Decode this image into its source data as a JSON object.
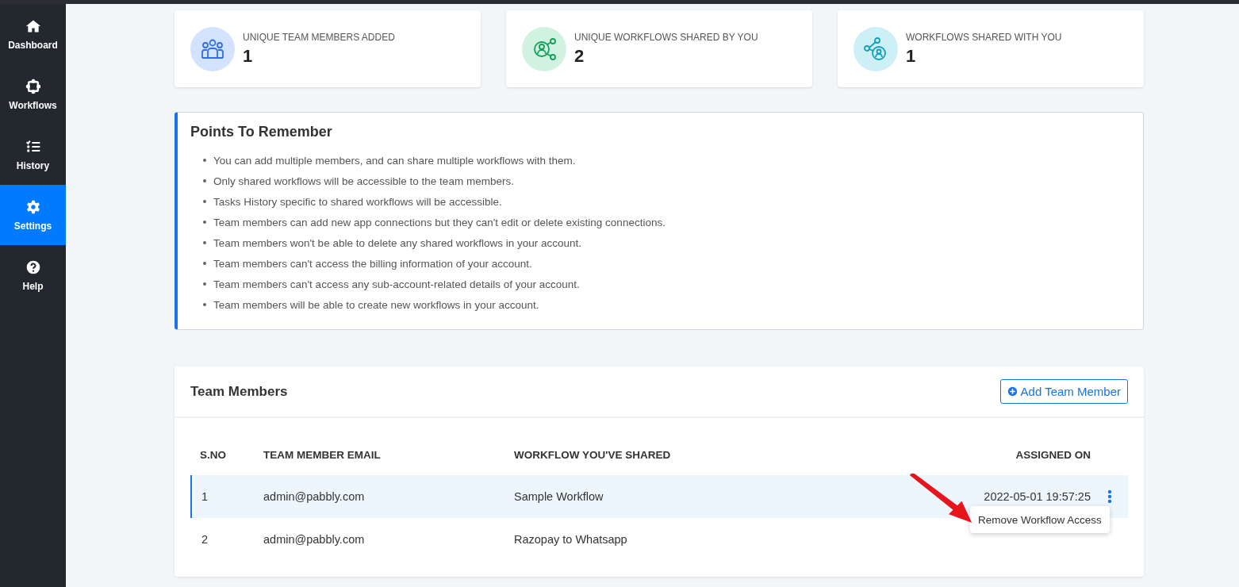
{
  "sidebar": {
    "items": [
      {
        "label": "Dashboard",
        "kind": "home",
        "selected": false
      },
      {
        "label": "Workflows",
        "kind": "workflow",
        "selected": false
      },
      {
        "label": "History",
        "kind": "history",
        "selected": false
      },
      {
        "label": "Settings",
        "kind": "gear",
        "selected": true
      },
      {
        "label": "Help",
        "kind": "help",
        "selected": false
      }
    ]
  },
  "stats": [
    {
      "label": "UNIQUE TEAM MEMBERS ADDED",
      "value": "1",
      "kind": "team",
      "color": "#d3e3fd"
    },
    {
      "label": "UNIQUE WORKFLOWS SHARED BY YOU",
      "value": "2",
      "kind": "share",
      "color": "#d1f2e1"
    },
    {
      "label": "WORKFLOWS SHARED WITH YOU",
      "value": "1",
      "kind": "shared",
      "color": "#cdf0f7"
    }
  ],
  "points": {
    "title": "Points To Remember",
    "items": [
      "You can add multiple members, and can share multiple workflows with them.",
      "Only shared workflows will be accessible to the team members.",
      "Tasks History specific to shared workflows will be accessible.",
      "Team members can add new app connections but they can't edit or delete existing connections.",
      "Team members won't be able to delete any shared workflows in your account.",
      "Team members can't access the billing information of your account.",
      "Team members can't access any sub-account-related details of your account.",
      "Team members will be able to create new workflows in your account."
    ]
  },
  "team": {
    "title": "Team Members",
    "add_button": "Add Team Member",
    "columns": [
      "S.NO",
      "TEAM MEMBER EMAIL",
      "WORKFLOW YOU'VE SHARED",
      "ASSIGNED ON"
    ],
    "rows": [
      {
        "sno": "1",
        "email": "admin@pabbly.com",
        "workflow": "Sample Workflow",
        "assigned": "2022-05-01 19:57:25",
        "selected": true
      },
      {
        "sno": "2",
        "email": "admin@pabbly.com",
        "workflow": "Razopay to Whatsapp",
        "selected": false
      }
    ],
    "menu": {
      "item": "Remove Workflow Access"
    }
  }
}
